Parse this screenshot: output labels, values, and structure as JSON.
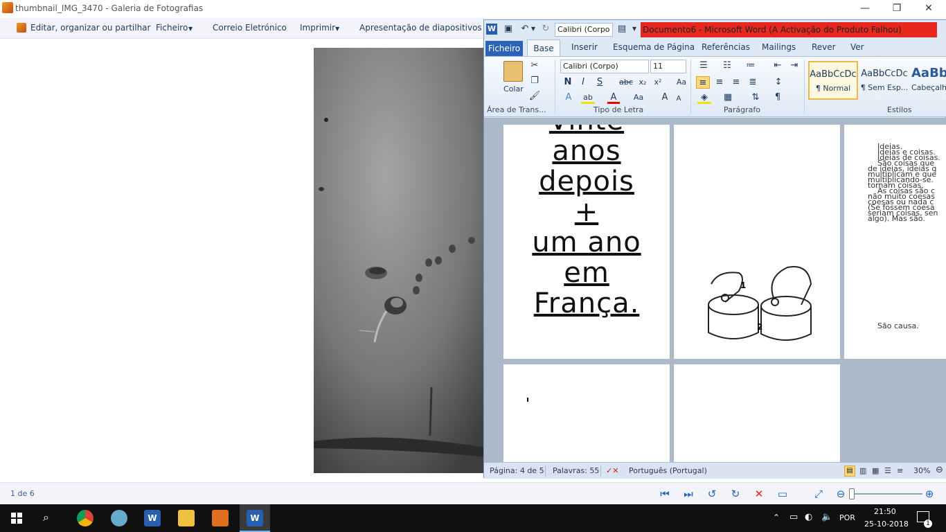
{
  "gallery": {
    "title": "thumbnail_IMG_3470 - Galeria de Fotografias",
    "menu": {
      "organize": "Editar, organizar ou partilhar",
      "file": "Ficheiro",
      "email": "Correio Eletrónico",
      "print": "Imprimir",
      "slideshow": "Apresentação de diapositivos"
    },
    "counter": "1 de 6"
  },
  "word": {
    "font_combo": "Calibri (Corpo",
    "title": "Documento6 - Microsoft Word (A Activação do Produto Falhou)",
    "tabs": {
      "file": "Ficheiro",
      "home": "Base",
      "insert": "Inserir",
      "layout": "Esquema de Página",
      "references": "Referências",
      "mailings": "Mailings",
      "review": "Rever",
      "view": "Ver"
    },
    "ribbon": {
      "paste": "Colar",
      "font_name": "Calibri (Corpo)",
      "font_size": "11",
      "bold": "N",
      "italic": "I",
      "underline": "S",
      "groups": {
        "clipboard": "Área de Trans...",
        "font": "Tipo de Letra",
        "paragraph": "Parágrafo",
        "styles": "Estilos"
      },
      "styles": [
        {
          "preview": "AaBbCcDc",
          "name": "¶ Normal"
        },
        {
          "preview": "AaBbCcDc",
          "name": "¶ Sem Esp..."
        },
        {
          "preview": "AaBbC",
          "name": "Cabeçalh"
        }
      ]
    },
    "pages": {
      "big_text": [
        "Vinte",
        "anos",
        "depois",
        "+",
        "um ano",
        "em",
        "França."
      ],
      "small_text": [
        "Ideias.",
        "Ideias e coisas.",
        "Ideias de coisas.",
        "São coisas que",
        "de ideias, ideias q",
        "multiplicam e que",
        "multiplicando-se.",
        "tornam coisas.",
        "As coisas são c",
        "não muito coesas",
        "coesas ou nada c",
        "(Se fossem coesa",
        "seriam coisas, sen",
        "algo). Mas são."
      ],
      "cause": "São causa."
    },
    "status": {
      "page": "Página: 4 de 5",
      "words": "Palavras: 55",
      "language": "Português (Portugal)",
      "zoom": "30%"
    }
  },
  "taskbar": {
    "lang": "POR",
    "time": "21:50",
    "date": "25-10-2018",
    "notif_count": "1"
  },
  "colors": {
    "word_title_bar": "#e8281f",
    "taskbar": "#101010",
    "file_tab": "#2a63b8"
  }
}
